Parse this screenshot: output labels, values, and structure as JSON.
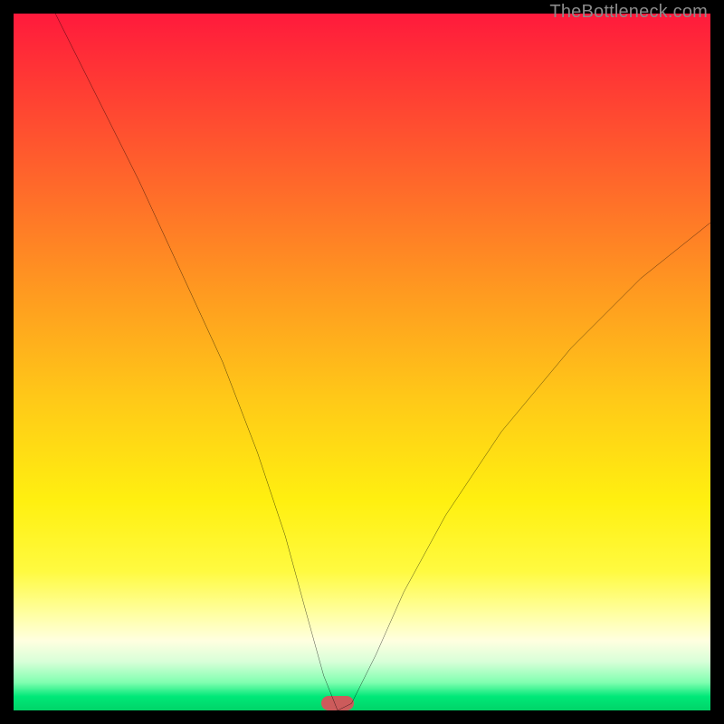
{
  "watermark": "TheBottleneck.com",
  "marker": {
    "cx_pct": 46.5,
    "cy_pct": 99.0
  },
  "chart_data": {
    "type": "line",
    "title": "",
    "xlabel": "",
    "ylabel": "",
    "xlim": [
      0,
      100
    ],
    "ylim": [
      0,
      100
    ],
    "legend": false,
    "grid": false,
    "series": [
      {
        "name": "bottleneck-curve",
        "x": [
          6,
          12,
          18,
          24,
          30,
          35,
          39,
          42,
          44.5,
          46.5,
          48.5,
          52,
          56,
          62,
          70,
          80,
          90,
          100
        ],
        "values": [
          100,
          88,
          76,
          63,
          50,
          37,
          25,
          14,
          5,
          0,
          1,
          8,
          17,
          28,
          40,
          52,
          62,
          70
        ]
      }
    ],
    "background_gradient": {
      "type": "vertical",
      "stops": [
        {
          "pct": 0,
          "color": "#ff1a3c"
        },
        {
          "pct": 25,
          "color": "#ff6a2a"
        },
        {
          "pct": 55,
          "color": "#ffc818"
        },
        {
          "pct": 80,
          "color": "#fffa40"
        },
        {
          "pct": 93,
          "color": "#d8ffd8"
        },
        {
          "pct": 100,
          "color": "#00d468"
        }
      ]
    },
    "optimal_marker": {
      "x": 46.5,
      "y": 0,
      "color": "#cc5b5b"
    }
  }
}
